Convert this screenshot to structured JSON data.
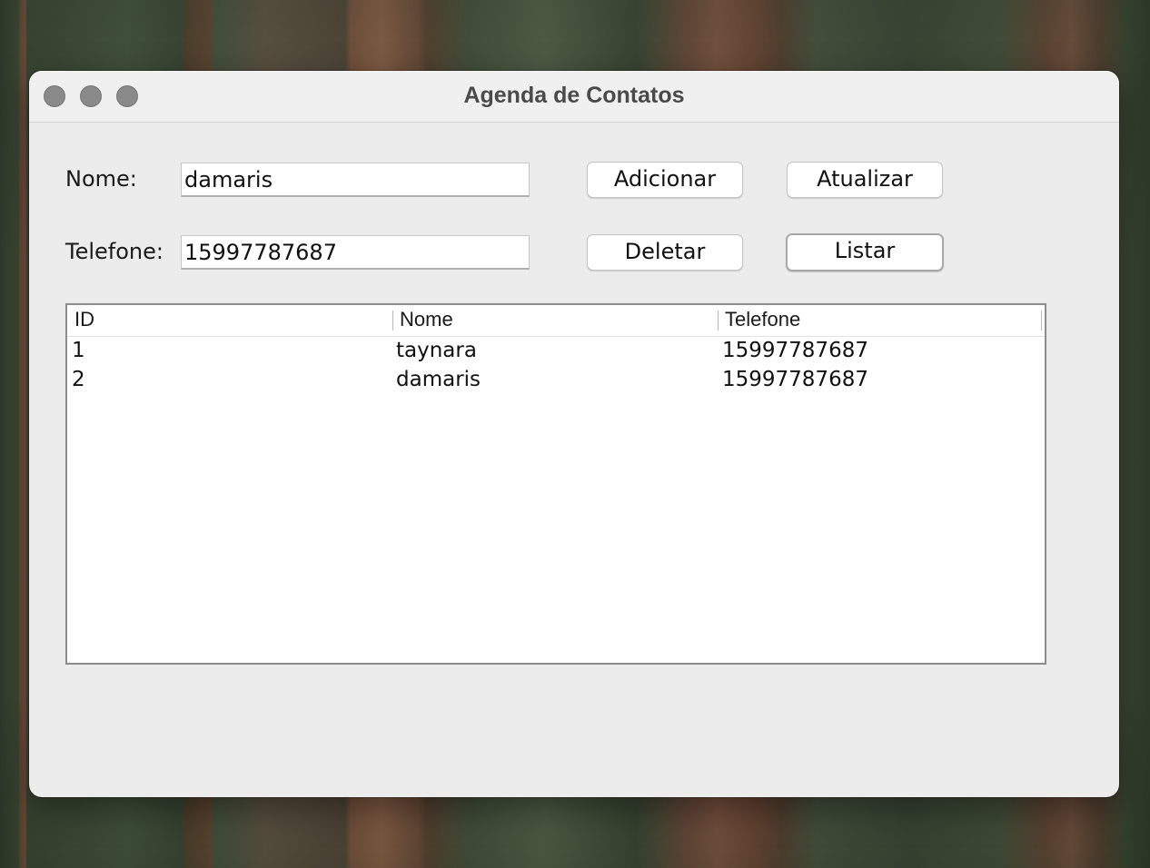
{
  "window": {
    "title": "Agenda de Contatos"
  },
  "form": {
    "nome_label": "Nome:",
    "nome_value": "damaris",
    "telefone_label": "Telefone:",
    "telefone_value": "15997787687"
  },
  "buttons": {
    "adicionar": "Adicionar",
    "atualizar": "Atualizar",
    "deletar": "Deletar",
    "listar": "Listar"
  },
  "table": {
    "columns": [
      "ID",
      "Nome",
      "Telefone"
    ],
    "rows": [
      [
        "1",
        "taynara",
        "15997787687"
      ],
      [
        "2",
        "damaris",
        "15997787687"
      ]
    ]
  }
}
